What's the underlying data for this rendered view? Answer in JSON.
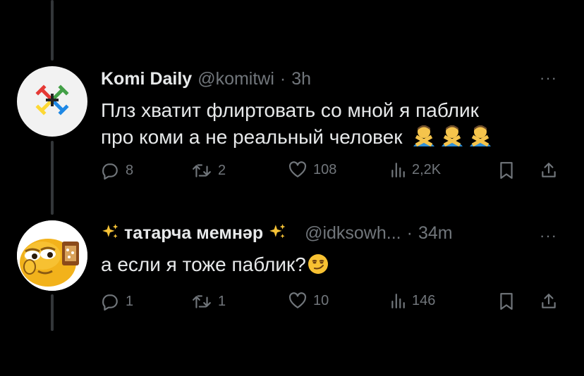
{
  "tweets": [
    {
      "author": "Komi Daily",
      "handle": "@komitwi",
      "sep": "·",
      "time": "3h",
      "more": "···",
      "line1": "Плз хватит флиртовать со мной я паблик",
      "line2": "про коми а не реальный человек",
      "emoji": "man-gesturing-no",
      "avatar": "komi-emblem",
      "actions": {
        "replies": "8",
        "reposts": "2",
        "likes": "108",
        "views": "2,2K"
      }
    },
    {
      "name_icon": "sparkles",
      "author": "татарча мемнәр",
      "handle": "@idksowh...",
      "sep": "·",
      "time": "34m",
      "more": "···",
      "line1": "а если я тоже паблик?",
      "emoji": "smirking-face",
      "avatar": "cartoon-character",
      "actions": {
        "replies": "1",
        "reposts": "1",
        "likes": "10",
        "views": "146"
      }
    }
  ],
  "colors": {
    "background": "#000000",
    "text": "#e7e9ea",
    "muted": "#71767b",
    "thread_line": "#333639"
  }
}
